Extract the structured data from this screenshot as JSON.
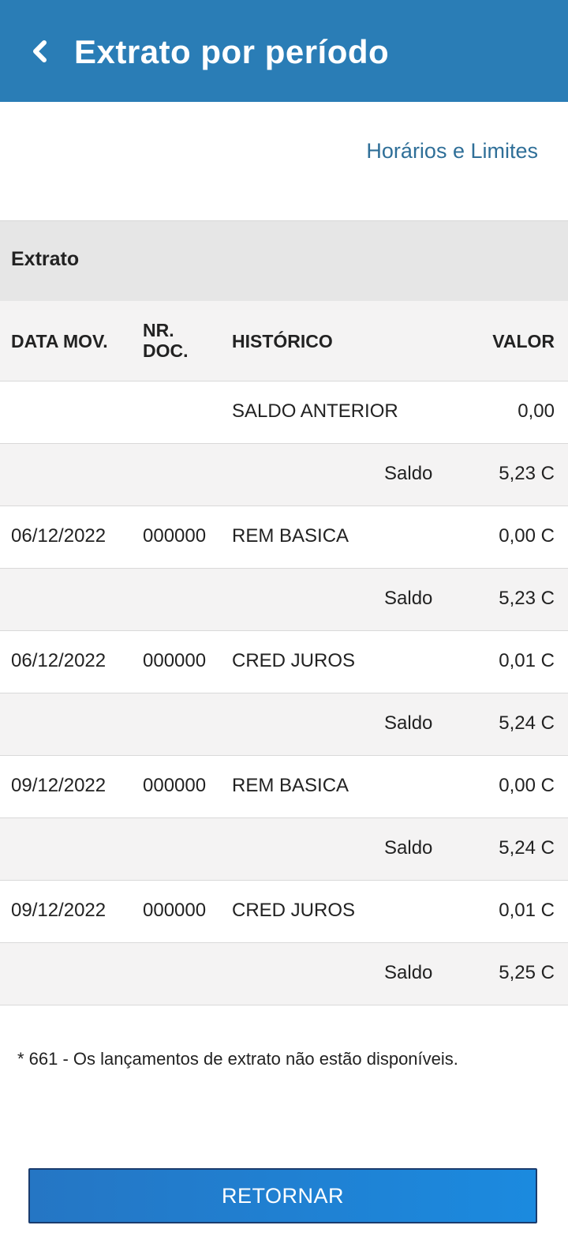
{
  "header": {
    "title": "Extrato por período",
    "back_icon": "chevron-left-icon",
    "background_color": "#2a7db6"
  },
  "links": {
    "limits": "Horários e Limites"
  },
  "section": {
    "title": "Extrato"
  },
  "table": {
    "columns": {
      "date": "DATA MOV.",
      "doc": "NR. DOC.",
      "history": "HISTÓRICO",
      "value": "VALOR"
    },
    "rows": [
      {
        "type": "entry",
        "date": "",
        "doc": "",
        "history": "SALDO ANTERIOR",
        "value": "0,00"
      },
      {
        "type": "saldo",
        "label": "Saldo",
        "value": "5,23 C"
      },
      {
        "type": "entry",
        "date": "06/12/2022",
        "doc": "000000",
        "history": "REM BASICA",
        "value": "0,00 C"
      },
      {
        "type": "saldo",
        "label": "Saldo",
        "value": "5,23 C"
      },
      {
        "type": "entry",
        "date": "06/12/2022",
        "doc": "000000",
        "history": "CRED JUROS",
        "value": "0,01 C"
      },
      {
        "type": "saldo",
        "label": "Saldo",
        "value": "5,24 C"
      },
      {
        "type": "entry",
        "date": "09/12/2022",
        "doc": "000000",
        "history": "REM BASICA",
        "value": "0,00 C"
      },
      {
        "type": "saldo",
        "label": "Saldo",
        "value": "5,24 C"
      },
      {
        "type": "entry",
        "date": "09/12/2022",
        "doc": "000000",
        "history": "CRED JUROS",
        "value": "0,01 C"
      },
      {
        "type": "saldo",
        "label": "Saldo",
        "value": "5,25 C"
      }
    ]
  },
  "footnote": "* 661 - Os lançamentos de extrato não estão disponíveis.",
  "buttons": {
    "return_label": "RETORNAR"
  }
}
